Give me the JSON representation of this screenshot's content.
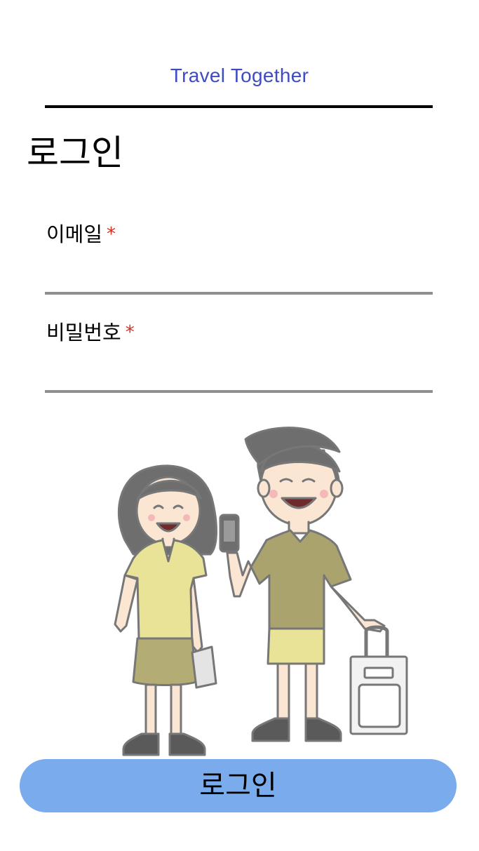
{
  "app": {
    "title": "Travel Together"
  },
  "login": {
    "heading": "로그인",
    "email_label": "이메일",
    "password_label": "비밀번호",
    "required_mark": "*",
    "email_value": "",
    "password_value": "",
    "submit_label": "로그인"
  },
  "theme": {
    "title_color": "#3d4cc4",
    "button_color": "#7aabec",
    "required_color": "#e02a1c",
    "underline_color": "#8f8f8f"
  },
  "illustration": {
    "description_icon": "travel-couple-illustration-icon"
  }
}
